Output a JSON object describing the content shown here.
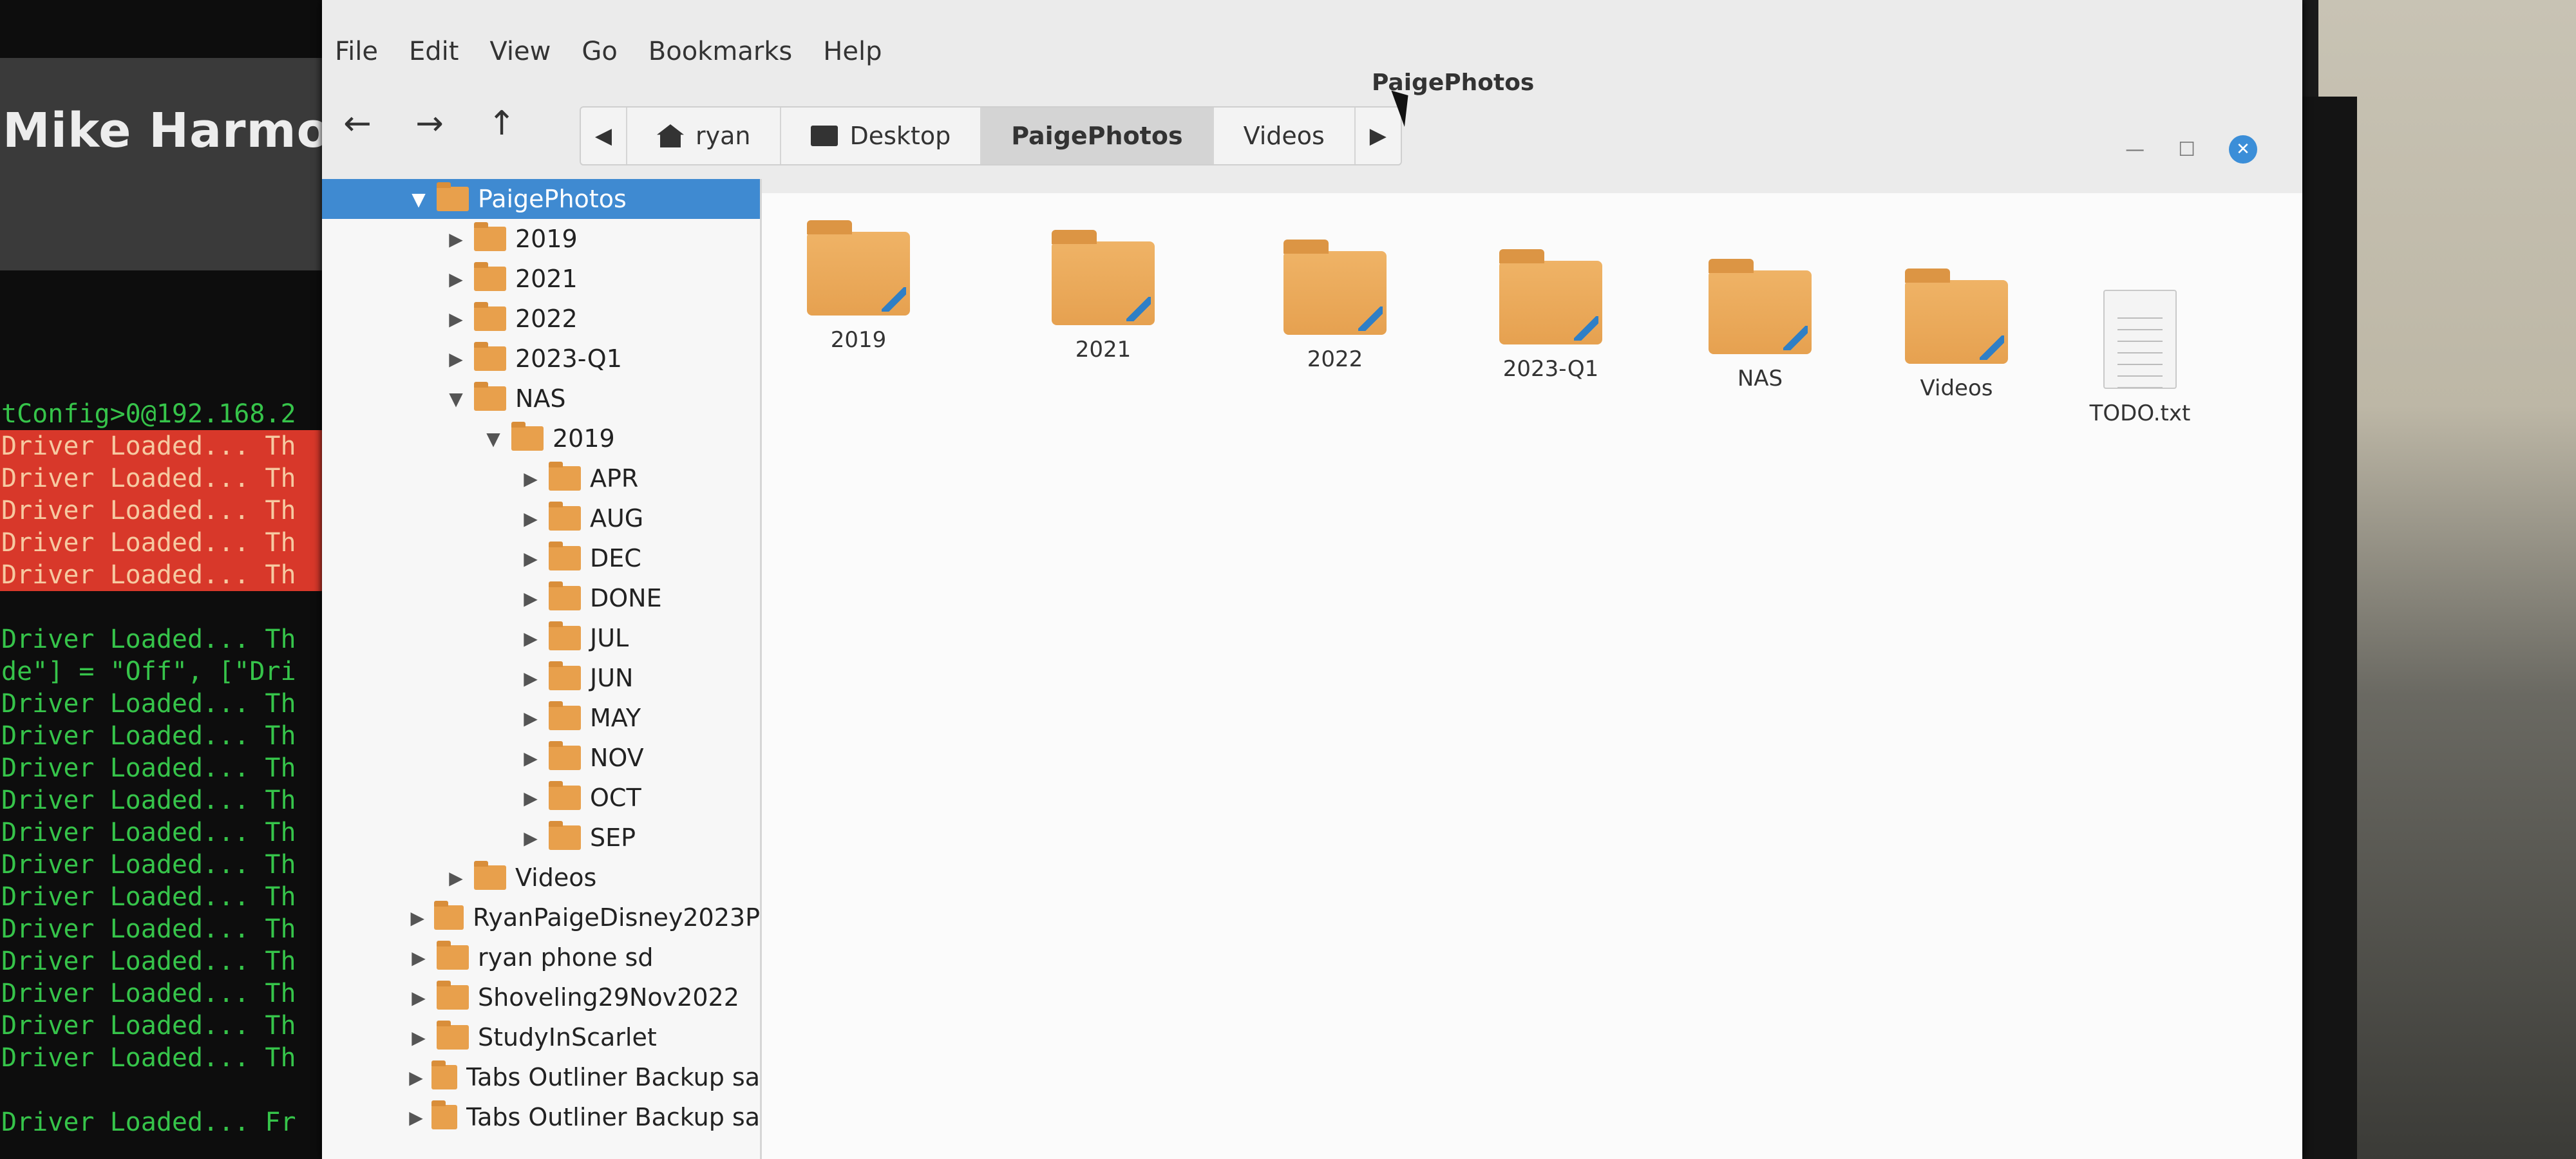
{
  "terminal": {
    "title": "Mike Harmony",
    "lines": [
      {
        "text": "tConfig>0@192.168.2",
        "error": false
      },
      {
        "text": "Driver Loaded... Th",
        "error": true
      },
      {
        "text": "Driver Loaded... Th",
        "error": true
      },
      {
        "text": "Driver Loaded... Th",
        "error": true
      },
      {
        "text": "Driver Loaded... Th",
        "error": true
      },
      {
        "text": "Driver Loaded... Th",
        "error": true
      },
      {
        "text": "",
        "error": false
      },
      {
        "text": "Driver Loaded... Th",
        "error": false
      },
      {
        "text": "de\"] = \"Off\", [\"Dri",
        "error": false
      },
      {
        "text": "Driver Loaded... Th",
        "error": false
      },
      {
        "text": "Driver Loaded... Th",
        "error": false
      },
      {
        "text": "Driver Loaded... Th",
        "error": false
      },
      {
        "text": "Driver Loaded... Th",
        "error": false
      },
      {
        "text": "Driver Loaded... Th",
        "error": false
      },
      {
        "text": "Driver Loaded... Th",
        "error": false
      },
      {
        "text": "Driver Loaded... Th",
        "error": false
      },
      {
        "text": "Driver Loaded... Th",
        "error": false
      },
      {
        "text": "Driver Loaded... Th",
        "error": false
      },
      {
        "text": "Driver Loaded... Th",
        "error": false
      },
      {
        "text": "Driver Loaded... Th",
        "error": false
      },
      {
        "text": "Driver Loaded... Th",
        "error": false
      },
      {
        "text": "",
        "error": false
      },
      {
        "text": "Driver Loaded... Fr",
        "error": false
      }
    ]
  },
  "window": {
    "title": "PaigePhotos",
    "menu": [
      "File",
      "Edit",
      "View",
      "Go",
      "Bookmarks",
      "Help"
    ],
    "controls": {
      "minimize": "—",
      "maximize": "☐",
      "close": "✕"
    },
    "nav": {
      "back": "←",
      "forward": "→",
      "up": "↑"
    },
    "path_left_arrow": "◀",
    "path_right_arrow": "▶",
    "breadcrumbs": [
      {
        "label": "ryan",
        "icon": "home-icon",
        "active": false
      },
      {
        "label": "Desktop",
        "icon": "desktop-icon",
        "active": false
      },
      {
        "label": "PaigePhotos",
        "icon": "",
        "active": true
      },
      {
        "label": "Videos",
        "icon": "",
        "active": false
      }
    ],
    "view_tools": [
      {
        "name": "toggle-location-icon",
        "glyph": "↵",
        "active": false
      },
      {
        "name": "search-icon",
        "glyph": "⌕",
        "active": false
      },
      {
        "name": "icon-view-icon",
        "glyph": "",
        "active": true
      },
      {
        "name": "list-view-icon",
        "glyph": "☰",
        "active": false
      },
      {
        "name": "compact-view-icon",
        "glyph": "⁞⁞",
        "active": false
      }
    ],
    "accent": "#3f8ad1",
    "folder_color": "#e8a04c"
  },
  "sidebar": {
    "tree": [
      {
        "label": "PaigePhotos",
        "depth": 0,
        "expanded": true,
        "selected": true
      },
      {
        "label": "2019",
        "depth": 1,
        "expanded": false,
        "selected": false
      },
      {
        "label": "2021",
        "depth": 1,
        "expanded": false,
        "selected": false
      },
      {
        "label": "2022",
        "depth": 1,
        "expanded": false,
        "selected": false
      },
      {
        "label": "2023-Q1",
        "depth": 1,
        "expanded": false,
        "selected": false
      },
      {
        "label": "NAS",
        "depth": 1,
        "expanded": true,
        "selected": false
      },
      {
        "label": "2019",
        "depth": 2,
        "expanded": true,
        "selected": false
      },
      {
        "label": "APR",
        "depth": 3,
        "expanded": false,
        "selected": false
      },
      {
        "label": "AUG",
        "depth": 3,
        "expanded": false,
        "selected": false
      },
      {
        "label": "DEC",
        "depth": 3,
        "expanded": false,
        "selected": false
      },
      {
        "label": "DONE",
        "depth": 3,
        "expanded": false,
        "selected": false
      },
      {
        "label": "JUL",
        "depth": 3,
        "expanded": false,
        "selected": false
      },
      {
        "label": "JUN",
        "depth": 3,
        "expanded": false,
        "selected": false
      },
      {
        "label": "MAY",
        "depth": 3,
        "expanded": false,
        "selected": false
      },
      {
        "label": "NOV",
        "depth": 3,
        "expanded": false,
        "selected": false
      },
      {
        "label": "OCT",
        "depth": 3,
        "expanded": false,
        "selected": false
      },
      {
        "label": "SEP",
        "depth": 3,
        "expanded": false,
        "selected": false
      },
      {
        "label": "Videos",
        "depth": 1,
        "expanded": false,
        "selected": false
      },
      {
        "label": "RyanPaigeDisney2023P",
        "depth": 0,
        "expanded": false,
        "selected": false
      },
      {
        "label": "ryan phone sd",
        "depth": 0,
        "expanded": false,
        "selected": false
      },
      {
        "label": "Shoveling29Nov2022",
        "depth": 0,
        "expanded": false,
        "selected": false
      },
      {
        "label": "StudyInScarlet",
        "depth": 0,
        "expanded": false,
        "selected": false
      },
      {
        "label": "Tabs Outliner Backup sa",
        "depth": 0,
        "expanded": false,
        "selected": false
      },
      {
        "label": "Tabs Outliner Backup sa",
        "depth": 0,
        "expanded": false,
        "selected": false
      }
    ]
  },
  "content": {
    "items": [
      {
        "label": "2019",
        "kind": "folder"
      },
      {
        "label": "2021",
        "kind": "folder"
      },
      {
        "label": "2022",
        "kind": "folder"
      },
      {
        "label": "2023-Q1",
        "kind": "folder"
      },
      {
        "label": "NAS",
        "kind": "folder"
      },
      {
        "label": "Videos",
        "kind": "folder"
      },
      {
        "label": "TODO.txt",
        "kind": "text-file"
      }
    ]
  }
}
